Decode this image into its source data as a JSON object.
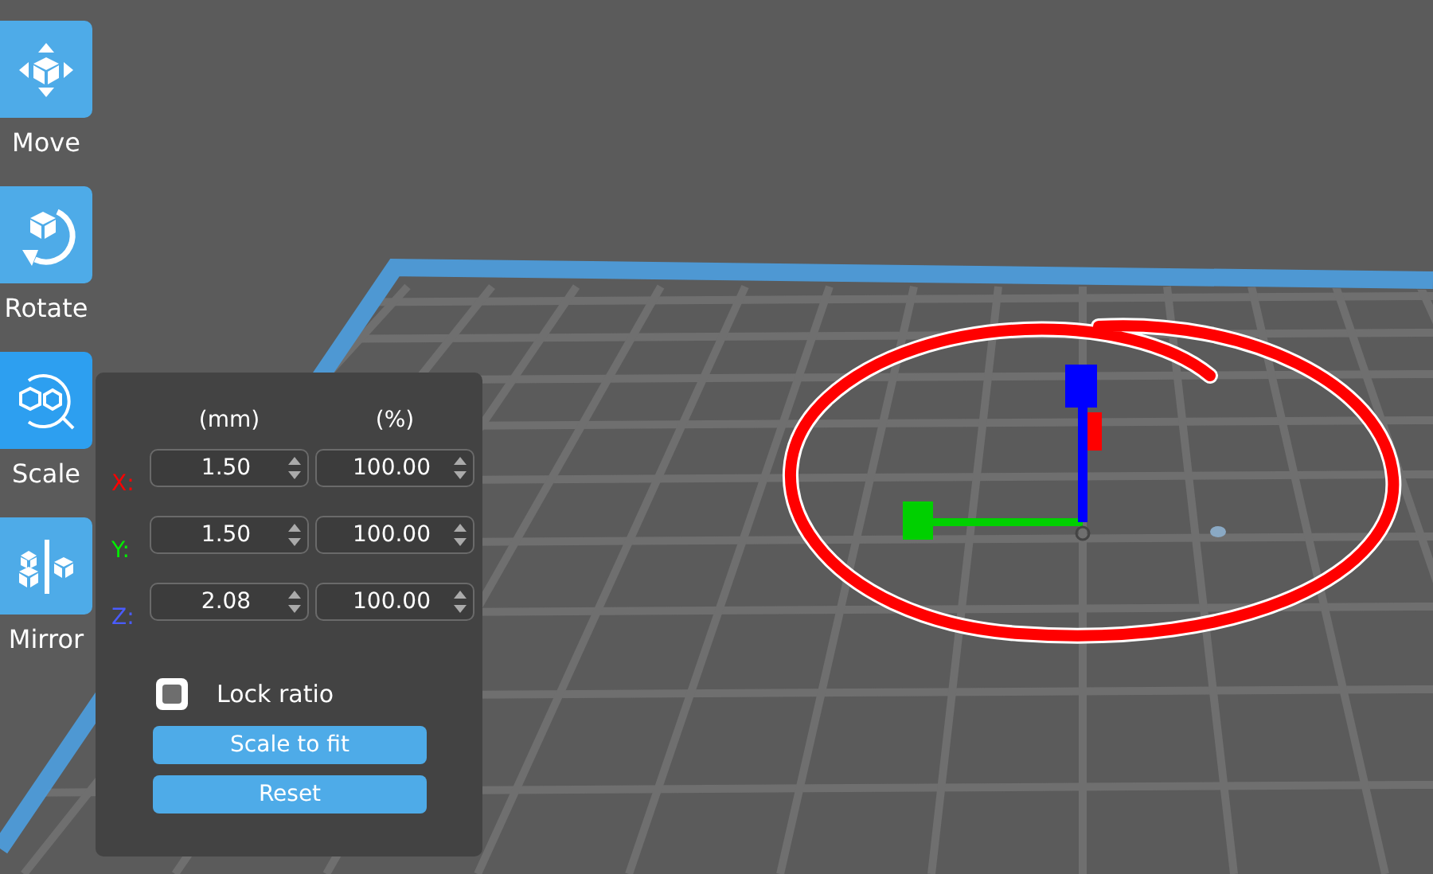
{
  "toolbar": {
    "tools": [
      {
        "kind": "move",
        "label": "Move",
        "selected": false
      },
      {
        "kind": "rotate",
        "label": "Rotate",
        "selected": false
      },
      {
        "kind": "scale",
        "label": "Scale",
        "selected": true
      },
      {
        "kind": "mirror",
        "label": "Mirror",
        "selected": false
      }
    ]
  },
  "scale_panel": {
    "headers": [
      "(mm)",
      "(%)"
    ],
    "rows": [
      {
        "axis": "X:",
        "color": "#ff0000",
        "mm": "1.50",
        "percent": "100.00"
      },
      {
        "axis": "Y:",
        "color": "#00ee00",
        "mm": "1.50",
        "percent": "100.00"
      },
      {
        "axis": "Z:",
        "color": "#4a5cff",
        "mm": "2.08",
        "percent": "100.00"
      }
    ],
    "lock_ratio": {
      "label": "Lock ratio",
      "checked": false
    },
    "buttons": [
      "Scale to fit",
      "Reset"
    ]
  }
}
